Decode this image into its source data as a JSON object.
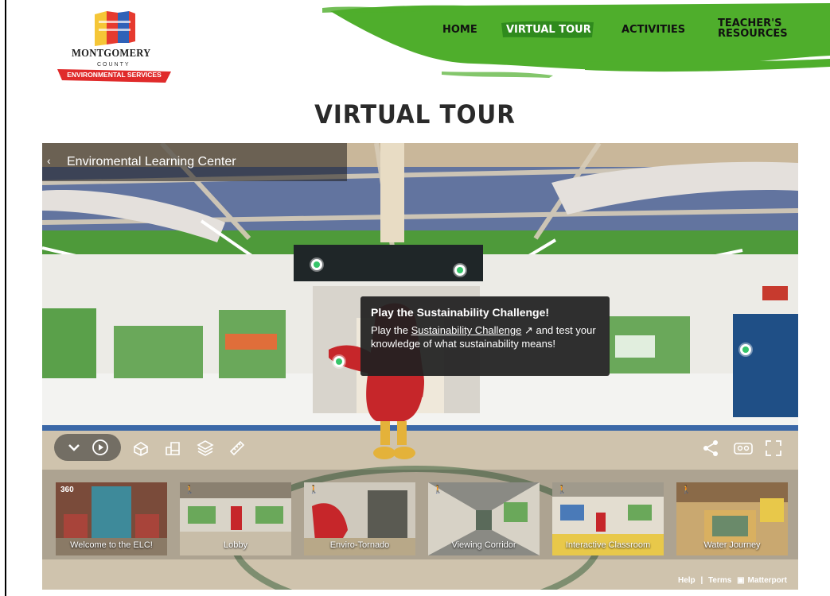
{
  "logo": {
    "name": "MONTGOMERY",
    "county": "COUNTY",
    "ribbon": "ENVIRONMENTAL SERVICES"
  },
  "nav": {
    "items": [
      {
        "label": "HOME"
      },
      {
        "label": "VIRTUAL TOUR",
        "active": true
      },
      {
        "label": "ACTIVITIES"
      },
      {
        "label": "TEACHER'S RESOURCES"
      }
    ]
  },
  "page": {
    "title": "VIRTUAL TOUR"
  },
  "tour": {
    "back_icon": "‹",
    "title": "Enviromental Learning Center"
  },
  "tooltip": {
    "title": "Play the Sustainability Challenge!",
    "body_prefix": "Play the ",
    "link_text": "Sustainability Challenge",
    "body_suffix": " and test your knowledge of what sustainability means!"
  },
  "thumbnails": [
    {
      "label": "Welcome to the ELC!",
      "icon": "360"
    },
    {
      "label": "Lobby",
      "icon": "walk"
    },
    {
      "label": "Enviro-Tornado",
      "icon": "walk"
    },
    {
      "label": "Viewing Corridor",
      "icon": "walk"
    },
    {
      "label": "Interactive Classroom",
      "icon": "walk"
    },
    {
      "label": "Water Journey",
      "icon": "walk"
    }
  ],
  "footer": {
    "help": "Help",
    "separator": "|",
    "terms": "Terms",
    "brand": "Matterport"
  },
  "colors": {
    "nav_green": "#4fae2c",
    "hotspot_green": "#36c56a",
    "ribbon_red": "#e02b2b"
  }
}
